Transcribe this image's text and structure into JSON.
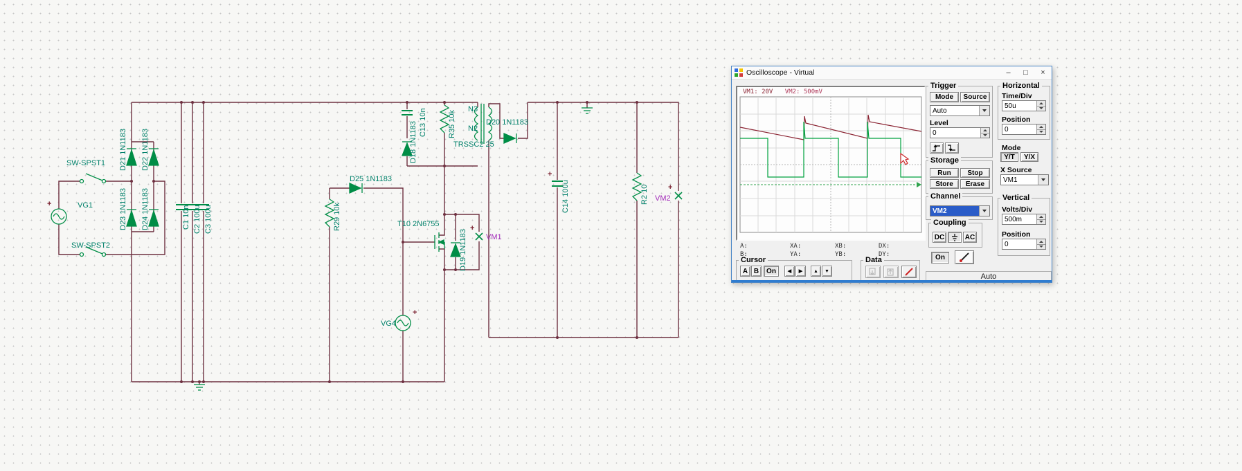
{
  "circuit": {
    "labels": {
      "d21": "D21 1N1183",
      "d22": "D22 1N1183",
      "d23": "D23 1N1183",
      "d24": "D24 1N1183",
      "sw1": "SW-SPST1",
      "sw2": "SW-SPST2",
      "vg1": "VG1",
      "c1": "C1 10n",
      "c2": "C2 100u",
      "c3": "C3 100u",
      "d18": "D18 1N1183",
      "c13": "C13 10n",
      "r35": "R35 10k",
      "n3": "N3",
      "n2": "N2",
      "tr": "TRSSC2 25",
      "d20": "D20 1N1183",
      "d25": "D25 1N1183",
      "r29": "R29 10k",
      "t10": "T10 2N6755",
      "d19": "D19 1N1183",
      "vm1": "VM1",
      "vm2": "VM2",
      "c14": "C14 100u",
      "r2": "R2 10",
      "vg4": "VG4"
    },
    "plus": "+",
    "colors": {
      "wire": "#6e3040",
      "component": "#008d46",
      "label": "#00806a",
      "meter_label": "#a128b8"
    }
  },
  "oscilloscope": {
    "title": "Oscilloscope - Virtual",
    "window_controls": {
      "minimize": "–",
      "maximize": "□",
      "close": "×"
    },
    "display": {
      "ch1_label": "VM1: 20V",
      "ch2_label": "VM2: 500mV",
      "trace_colors": {
        "vm1": "#8b2433",
        "vm2": "#00a13e"
      }
    },
    "readouts": {
      "a": "A:",
      "b": "B:",
      "xa": "XA:",
      "ya": "YA:",
      "xb": "XB:",
      "yb": "YB:",
      "dx": "DX:",
      "dy": "DY:"
    },
    "cursor": {
      "label": "Cursor",
      "a": "A",
      "b": "B",
      "on": "On",
      "left": "◀",
      "right": "▶",
      "top": "▲",
      "bottom": "▼"
    },
    "data_group": {
      "label": "Data"
    },
    "trigger": {
      "label": "Trigger",
      "mode_button": "Mode",
      "source_button": "Source",
      "mode_value": "Auto",
      "level_label": "Level",
      "level_value": "0"
    },
    "storage": {
      "label": "Storage",
      "run": "Run",
      "stop": "Stop",
      "store": "Store",
      "erase": "Erase"
    },
    "channel": {
      "label": "Channel",
      "selected": "VM2"
    },
    "coupling": {
      "label": "Coupling",
      "dc": "DC",
      "ac": "AC"
    },
    "on_button": "On",
    "horizontal": {
      "label": "Horizontal",
      "timediv_label": "Time/Div",
      "timediv_value": "50u",
      "position_label": "Position",
      "position_value": "0",
      "mode_label": "Mode",
      "yt": "Y/T",
      "yx": "Y/X",
      "xsource_label": "X Source",
      "xsource_value": "VM1"
    },
    "vertical": {
      "label": "Vertical",
      "voltsdiv_label": "Volts/Div",
      "voltsdiv_value": "500m",
      "position_label": "Position",
      "position_value": "0"
    },
    "status": "Auto"
  }
}
